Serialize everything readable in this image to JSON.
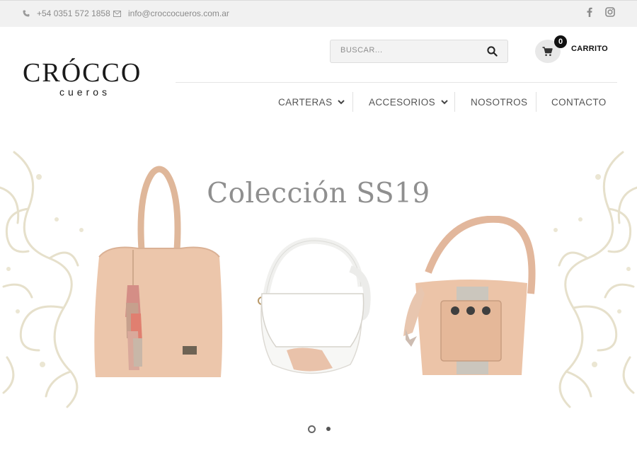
{
  "topbar": {
    "phone_icon": "phone-icon",
    "phone": "+54 0351 572 1858",
    "email_icon": "envelope-icon",
    "email": "info@croccocueros.com.ar",
    "social": [
      "facebook-icon",
      "instagram-icon"
    ]
  },
  "logo": {
    "word": "CRÓCCO",
    "sub": "cueros"
  },
  "search": {
    "placeholder": "BUSCAR...",
    "icon": "search-icon"
  },
  "cart": {
    "icon": "cart-icon",
    "count": "0",
    "label": "CARRITO"
  },
  "nav": {
    "items": [
      {
        "label": "CARTERAS",
        "has_dropdown": true
      },
      {
        "label": "ACCESORIOS",
        "has_dropdown": true
      },
      {
        "label": "NOSOTROS",
        "has_dropdown": false
      },
      {
        "label": "CONTACTO",
        "has_dropdown": false
      }
    ]
  },
  "hero": {
    "title": "Colección SS19",
    "slides_total": 2,
    "active_slide": 1
  },
  "colors": {
    "topbar_bg": "#f1f1f1",
    "bag_tan": "#ecc7ac",
    "bag_white": "#f7f7f5",
    "ornament": "#e9e4d2",
    "text": "#555555"
  }
}
